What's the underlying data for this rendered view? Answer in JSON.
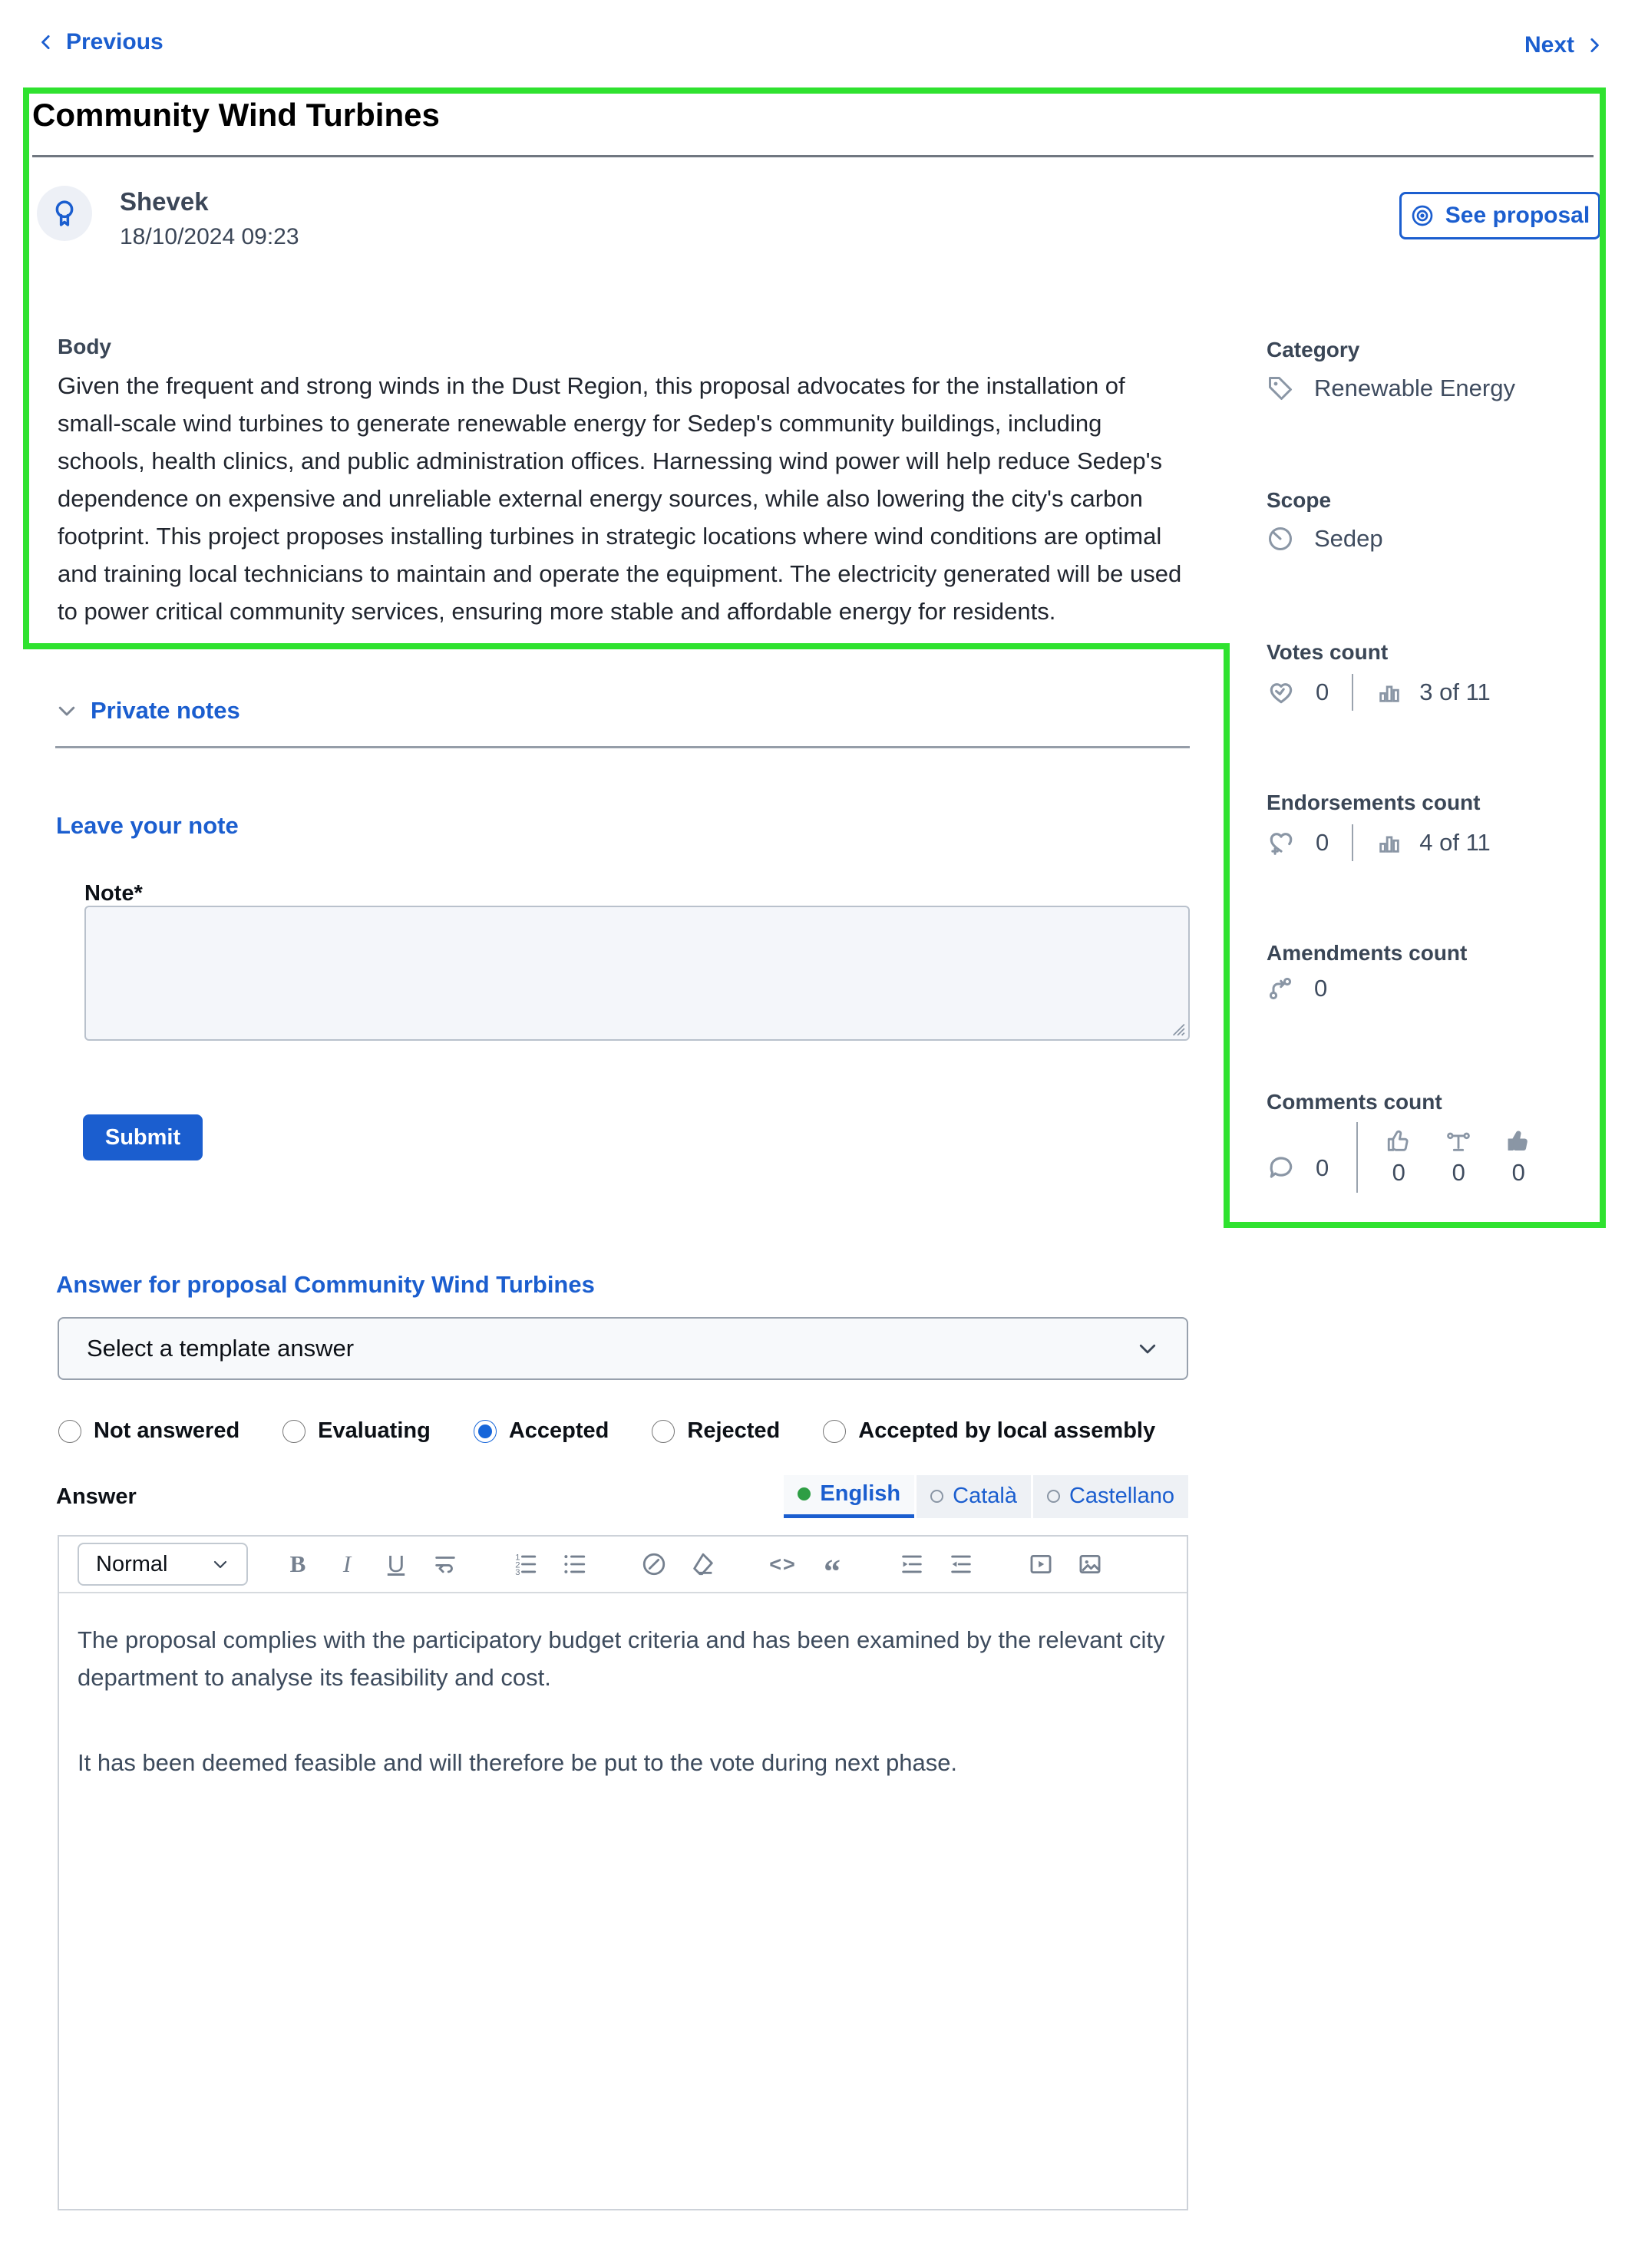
{
  "nav": {
    "previous": "Previous",
    "next": "Next"
  },
  "proposal": {
    "title": "Community Wind Turbines",
    "author": {
      "name": "Shevek",
      "date": "18/10/2024 09:23"
    },
    "see_proposal_label": "See proposal",
    "body_label": "Body",
    "body": "Given the frequent and strong winds in the Dust Region, this proposal advocates for the installation of small-scale wind turbines to generate renewable energy for Sedep's community buildings, including schools, health clinics, and public administration offices. Harnessing wind power will help reduce Sedep's dependence on expensive and unreliable external energy sources, while also lowering the city's carbon footprint. This project proposes installing turbines in strategic locations where wind conditions are optimal and training local technicians to maintain and operate the equipment. The electricity generated will be used to power critical community services, ensuring more stable and affordable energy for residents."
  },
  "sidebar": {
    "category": {
      "label": "Category",
      "value": "Renewable Energy",
      "icon": "tag-icon"
    },
    "scope": {
      "label": "Scope",
      "value": "Sedep",
      "icon": "scope-icon"
    },
    "votes": {
      "label": "Votes count",
      "count": "0",
      "ranking": "3 of 11"
    },
    "endorsements": {
      "label": "Endorsements count",
      "count": "0",
      "ranking": "4 of 11"
    },
    "amendments": {
      "label": "Amendments count",
      "count": "0"
    },
    "comments": {
      "label": "Comments count",
      "count": "0",
      "up_count": "0",
      "neutral_count": "0",
      "down_count": "0"
    }
  },
  "private_notes": {
    "title": "Private notes",
    "leave_note_heading": "Leave your note",
    "note_label": "Note*",
    "note_value": "",
    "submit_label": "Submit"
  },
  "answer": {
    "heading": "Answer for proposal Community Wind Turbines",
    "template_placeholder": "Select a template answer",
    "statuses": [
      {
        "label": "Not answered",
        "checked": false
      },
      {
        "label": "Evaluating",
        "checked": false
      },
      {
        "label": "Accepted",
        "checked": true
      },
      {
        "label": "Rejected",
        "checked": false
      },
      {
        "label": "Accepted by local assembly",
        "checked": false
      }
    ],
    "answer_label": "Answer",
    "languages": [
      {
        "label": "English",
        "active": true,
        "translated": true
      },
      {
        "label": "Català",
        "active": false,
        "translated": false
      },
      {
        "label": "Castellano",
        "active": false,
        "translated": false
      }
    ],
    "editor": {
      "style_name": "Normal",
      "paragraphs": [
        "The proposal complies with the participatory budget criteria and has been examined by the relevant city department to analyse its feasibility and cost.",
        "It has been deemed feasible and will therefore be put to the vote during next phase."
      ]
    }
  },
  "colors": {
    "primary_blue": "#1b5ecf",
    "annotation_green": "#2fe22f",
    "label_slate": "#3a4656",
    "icon_gray": "#8a96a5"
  }
}
